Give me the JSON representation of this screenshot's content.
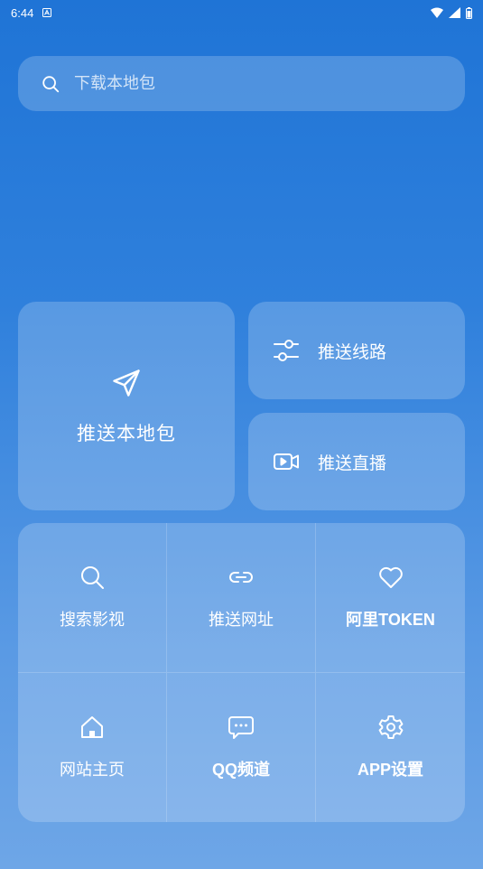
{
  "status_bar": {
    "time": "6:44"
  },
  "search": {
    "placeholder": "下载本地包"
  },
  "big_tile": {
    "label": "推送本地包",
    "icon": "send-icon"
  },
  "small_tiles": [
    {
      "label": "推送线路",
      "icon": "sliders-icon"
    },
    {
      "label": "推送直播",
      "icon": "video-icon"
    }
  ],
  "grid": [
    {
      "label": "搜索影视",
      "icon": "search-icon"
    },
    {
      "label": "推送网址",
      "icon": "link-icon"
    },
    {
      "label": "阿里TOKEN",
      "icon": "heart-icon"
    },
    {
      "label": "网站主页",
      "icon": "home-icon"
    },
    {
      "label": "QQ频道",
      "icon": "chat-icon"
    },
    {
      "label": "APP设置",
      "icon": "gear-icon"
    }
  ],
  "colors": {
    "background_top": "#1f74d6",
    "background_bottom": "#6ea6e7",
    "tile": "rgba(255,255,255,0.2)",
    "text": "#ffffff"
  }
}
